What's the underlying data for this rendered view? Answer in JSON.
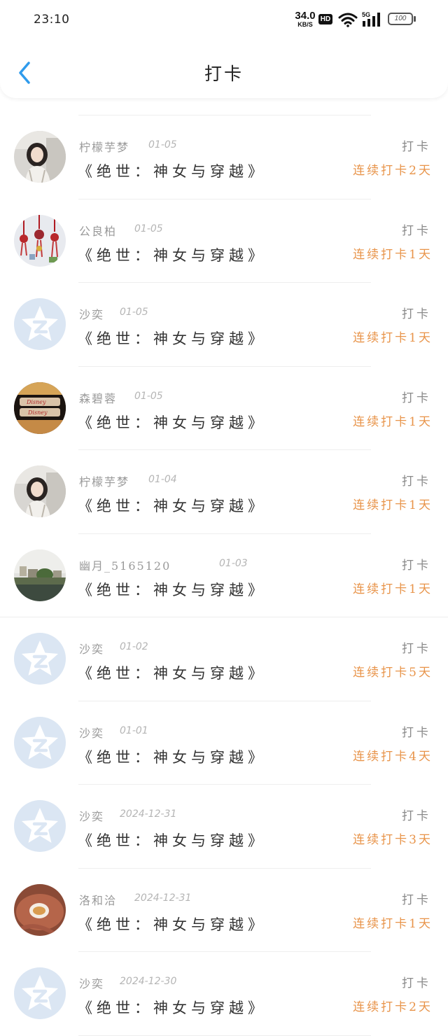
{
  "status_bar": {
    "time": "23:10",
    "net_speed_value": "34.0",
    "net_speed_unit": "KB/S",
    "hd": "HD",
    "network": "5G",
    "battery": "100"
  },
  "header": {
    "title": "打卡",
    "accent_color": "#2f9bec"
  },
  "streak_color": "#e8944a",
  "items": [
    {
      "user": "柠檬芋梦",
      "date": "01-05",
      "book": "《绝世：神女与穿越》",
      "action": "打卡",
      "streak": "连续打卡2天",
      "avatar": "girl-photo-avatar"
    },
    {
      "user": "公良柏",
      "date": "01-05",
      "book": "《绝世：神女与穿越》",
      "action": "打卡",
      "streak": "连续打卡1天",
      "avatar": "chinese-knot-avatar"
    },
    {
      "user": "沙奕",
      "date": "01-05",
      "book": "《绝世：神女与穿越》",
      "action": "打卡",
      "streak": "连续打卡1天",
      "avatar": "default-star-avatar"
    },
    {
      "user": "森碧蓉",
      "date": "01-05",
      "book": "《绝世：神女与穿越》",
      "action": "打卡",
      "streak": "连续打卡1天",
      "avatar": "disney-sign-avatar"
    },
    {
      "user": "柠檬芋梦",
      "date": "01-04",
      "book": "《绝世：神女与穿越》",
      "action": "打卡",
      "streak": "连续打卡1天",
      "avatar": "girl-photo-avatar"
    },
    {
      "user": "幽月_5165120",
      "date": "01-03",
      "book": "《绝世：神女与穿越》",
      "action": "打卡",
      "streak": "连续打卡1天",
      "avatar": "landscape-avatar"
    },
    {
      "user": "沙奕",
      "date": "01-02",
      "book": "《绝世：神女与穿越》",
      "action": "打卡",
      "streak": "连续打卡5天",
      "avatar": "default-star-avatar"
    },
    {
      "user": "沙奕",
      "date": "01-01",
      "book": "《绝世：神女与穿越》",
      "action": "打卡",
      "streak": "连续打卡4天",
      "avatar": "default-star-avatar"
    },
    {
      "user": "沙奕",
      "date": "2024-12-31",
      "book": "《绝世：神女与穿越》",
      "action": "打卡",
      "streak": "连续打卡3天",
      "avatar": "default-star-avatar"
    },
    {
      "user": "洛和洽",
      "date": "2024-12-31",
      "book": "《绝世：神女与穿越》",
      "action": "打卡",
      "streak": "连续打卡1天",
      "avatar": "tea-cup-avatar"
    },
    {
      "user": "沙奕",
      "date": "2024-12-30",
      "book": "《绝世：神女与穿越》",
      "action": "打卡",
      "streak": "连续打卡2天",
      "avatar": "default-star-avatar"
    }
  ]
}
